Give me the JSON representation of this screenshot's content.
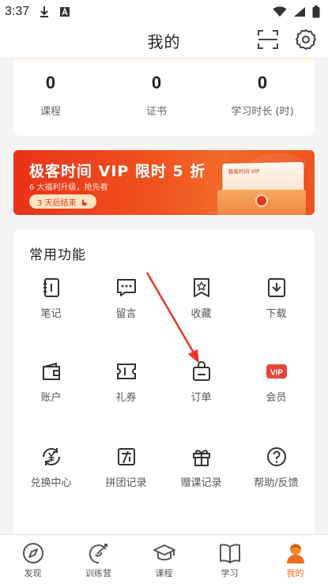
{
  "status_bar": {
    "time": "3:37"
  },
  "header": {
    "title": "我的"
  },
  "stats": [
    {
      "value": "0",
      "label": "课程"
    },
    {
      "value": "0",
      "label": "证书"
    },
    {
      "value": "0",
      "label": "学习时长 (时)"
    }
  ],
  "banner": {
    "title": "极客时间 VIP 限时 5 折",
    "subtitle": "6 大福利升级，抢先看",
    "pill": "3 天后结束",
    "card_text": "极客时间 VIP"
  },
  "functions": {
    "title": "常用功能",
    "items": [
      {
        "label": "笔记",
        "icon": "notebook-icon"
      },
      {
        "label": "留言",
        "icon": "comment-icon"
      },
      {
        "label": "收藏",
        "icon": "bookmark-star-icon"
      },
      {
        "label": "下载",
        "icon": "download-icon"
      },
      {
        "label": "账户",
        "icon": "wallet-icon"
      },
      {
        "label": "礼券",
        "icon": "coupon-icon"
      },
      {
        "label": "订单",
        "icon": "order-bag-icon"
      },
      {
        "label": "会员",
        "icon": "vip-badge-icon"
      },
      {
        "label": "兑换中心",
        "icon": "exchange-yuan-icon"
      },
      {
        "label": "拼团记录",
        "icon": "group-buy-icon"
      },
      {
        "label": "赠课记录",
        "icon": "gift-icon"
      },
      {
        "label": "帮助/反馈",
        "icon": "help-icon"
      }
    ],
    "vip_badge_text": "VIP"
  },
  "bottom_nav": [
    {
      "label": "发现",
      "icon": "compass-icon",
      "active": false
    },
    {
      "label": "训练营",
      "icon": "training-icon",
      "active": false
    },
    {
      "label": "课程",
      "icon": "graduation-cap-icon",
      "active": false
    },
    {
      "label": "学习",
      "icon": "open-book-icon",
      "active": false
    },
    {
      "label": "我的",
      "icon": "profile-avatar-icon",
      "active": true
    }
  ],
  "colors": {
    "accent": "#f26b1d",
    "banner_red": "#e8331a",
    "annotation_arrow": "#e8352b"
  }
}
